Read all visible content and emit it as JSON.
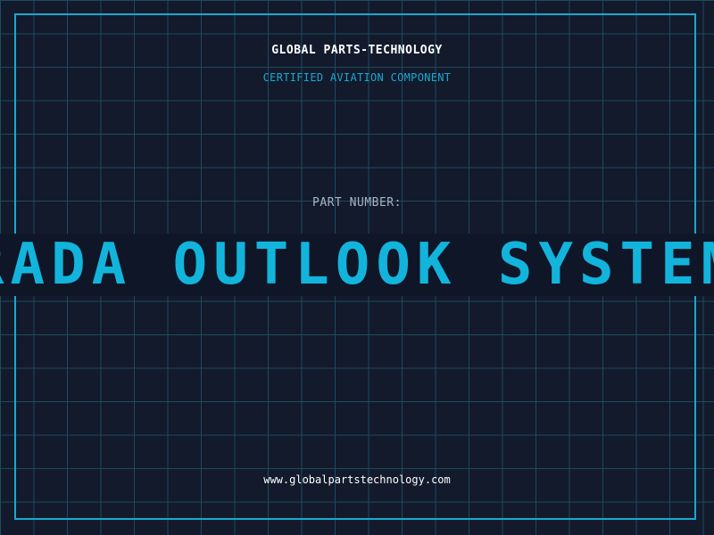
{
  "header": {
    "company": "GLOBAL PARTS-TECHNOLOGY",
    "tagline": "CERTIFIED AVIATION COMPONENT"
  },
  "part": {
    "label": "PART NUMBER:",
    "name": "RADA OUTLOOK SYSTEM"
  },
  "footer": {
    "website": "www.globalpartstechnology.com"
  },
  "colors": {
    "background": "#121a2c",
    "grid": "#1f4a5e",
    "accent": "#1aa8d0",
    "banner_text": "#12b4dc",
    "banner_bg": "#0f1628"
  }
}
